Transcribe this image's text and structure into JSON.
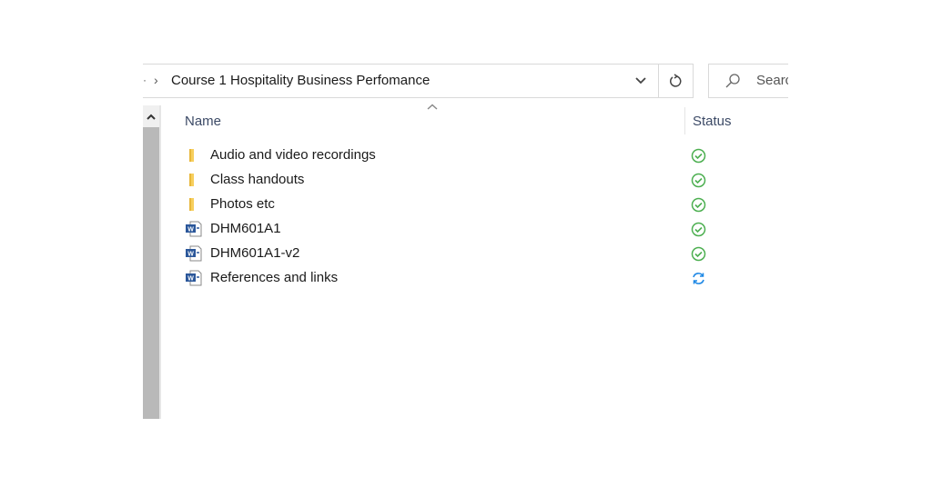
{
  "address_bar": {
    "breadcrumb": "Course 1 Hospitality Business Perfomance",
    "dropdown_icon": "chevron-down-icon",
    "refresh_icon": "refresh-icon"
  },
  "search": {
    "placeholder": "Search",
    "visible_text": "Searc"
  },
  "columns": {
    "name": "Name",
    "status": "Status",
    "sort": "ascending"
  },
  "files": [
    {
      "name": "Audio and video recordings",
      "type": "folder",
      "status": "synced"
    },
    {
      "name": "Class handouts",
      "type": "folder",
      "status": "synced"
    },
    {
      "name": "Photos etc",
      "type": "folder",
      "status": "synced"
    },
    {
      "name": "DHM601A1",
      "type": "word-document",
      "status": "synced"
    },
    {
      "name": "DHM601A1-v2",
      "type": "word-document",
      "status": "synced"
    },
    {
      "name": "References and links",
      "type": "word-document",
      "status": "syncing"
    }
  ],
  "colors": {
    "synced": "#4caf50",
    "syncing": "#1e88e5",
    "folder": "#f5c542",
    "word": "#2b579a"
  }
}
